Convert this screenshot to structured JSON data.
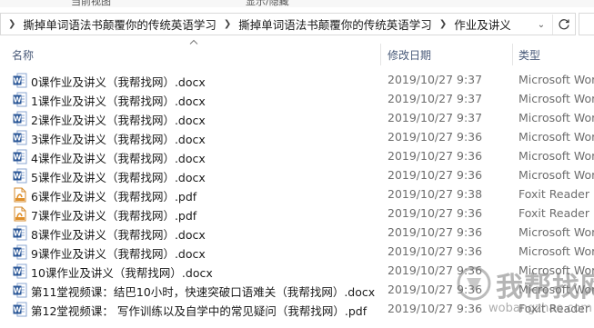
{
  "ribbon_fragments": [
    "当前视图",
    "显示/隐藏"
  ],
  "breadcrumb": [
    "撕掉单词语法书颠覆你的传统英语学习",
    "撕掉单词语法书颠覆你的传统英语学习",
    "作业及讲义"
  ],
  "columns": {
    "name": "名称",
    "date": "修改日期",
    "type": "类型"
  },
  "files": [
    {
      "icon": "word-doc-icon",
      "name": "0课作业及讲义（我帮找网）.docx",
      "date": "2019/10/27 9:37",
      "type": "Microsoft Word"
    },
    {
      "icon": "word-doc-icon",
      "name": "1课作业及讲义（我帮找网）.docx",
      "date": "2019/10/27 9:37",
      "type": "Microsoft Word"
    },
    {
      "icon": "word-doc-icon",
      "name": "2课作业及讲义（我帮找网）.docx",
      "date": "2019/10/27 9:37",
      "type": "Microsoft Word"
    },
    {
      "icon": "word-doc-icon",
      "name": "3课作业及讲义（我帮找网）.docx",
      "date": "2019/10/27 9:36",
      "type": "Microsoft Word"
    },
    {
      "icon": "word-doc-icon",
      "name": "4课作业及讲义（我帮找网）.docx",
      "date": "2019/10/27 9:36",
      "type": "Microsoft Word"
    },
    {
      "icon": "word-doc-icon",
      "name": "5课作业及讲义（我帮找网）.docx",
      "date": "2019/10/27 9:36",
      "type": "Microsoft Word"
    },
    {
      "icon": "pdf-icon",
      "name": "6课作业及讲义（我帮找网）.pdf",
      "date": "2019/10/27 9:38",
      "type": "Foxit Reader PDF"
    },
    {
      "icon": "pdf-icon",
      "name": "7课作业及讲义（我帮找网）.pdf",
      "date": "2019/10/27 9:36",
      "type": "Foxit Reader PDF"
    },
    {
      "icon": "word-doc-icon",
      "name": "8课作业及讲义（我帮找网）.docx",
      "date": "2019/10/27 9:36",
      "type": "Microsoft Word"
    },
    {
      "icon": "word-doc-icon",
      "name": "9课作业及讲义（我帮找网）.docx",
      "date": "2019/10/27 9:36",
      "type": "Microsoft Word"
    },
    {
      "icon": "word-doc-icon",
      "name": "10课作业及讲义（我帮找网）.docx",
      "date": "2019/10/27 9:36",
      "type": "Microsoft Word"
    },
    {
      "icon": "word-doc-icon",
      "name": "第11堂视频课：结巴10小时，快速突破口语难关（我帮找网）.docx",
      "date": "2019/10/27 9:36",
      "type": "Microsoft Word"
    },
    {
      "icon": "word-doc-icon",
      "name": "第12堂视频课： 写作训练以及自学中的常见疑问（我帮找网）.pdf",
      "date": "2019/10/27 9:36",
      "type": "Foxit Reader PDF"
    }
  ],
  "watermark": {
    "text": "我帮找网",
    "url": "wobangzhao.com"
  },
  "colors": {
    "word_blue": "#2b5797",
    "pdf_orange": "#e0902a",
    "header_text": "#4a5b7a"
  }
}
